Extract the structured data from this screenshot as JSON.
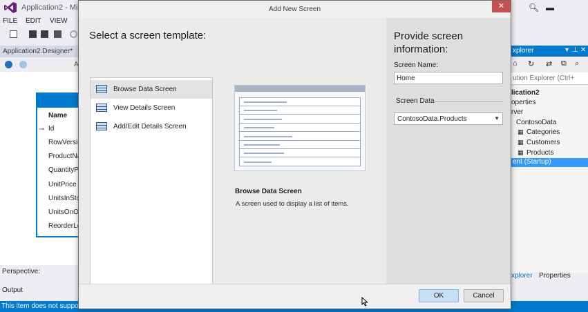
{
  "ide": {
    "title": "Application2 - Micr",
    "menu": [
      "FILE",
      "EDIT",
      "VIEW"
    ],
    "doc_tab": "Application2.Designer*",
    "nav_fragment": "A",
    "entity": {
      "header": "Name",
      "rows": [
        "Id",
        "RowVersic",
        "ProductNa",
        "QuantityP",
        "UnitPrice",
        "UnitsInSto",
        "UnitsOnO",
        "ReorderLe"
      ]
    },
    "perspective_label": "Perspective:",
    "output_label": "Output",
    "status_text": "This item does not support",
    "accent_color": "#007acc"
  },
  "solution_explorer": {
    "header": "xplorer",
    "search_placeholder": "ution Explorer (Ctrl+",
    "tree": [
      {
        "label": "lication2",
        "bold": true
      },
      {
        "label": "operties"
      },
      {
        "label": "rver"
      },
      {
        "label": "ContosoData"
      },
      {
        "label": "Categories"
      },
      {
        "label": "Customers"
      },
      {
        "label": "Products"
      },
      {
        "label": "ent (Startup)",
        "selected": true
      }
    ],
    "tabs": [
      "xplorer",
      "Properties"
    ]
  },
  "dialog": {
    "title": "Add New Screen",
    "close_label": "✕",
    "left_heading": "Select a screen template:",
    "templates": [
      {
        "label": "Browse Data Screen",
        "selected": true
      },
      {
        "label": "View Details Screen"
      },
      {
        "label": "Add/Edit Details Screen"
      }
    ],
    "preview_rows": 8,
    "description_title": "Browse Data Screen",
    "description_text": "A screen used to display a list of items.",
    "right_heading": "Provide screen information:",
    "screen_name_label": "Screen Name:",
    "screen_name_value": "Home",
    "screen_data_label": "Screen Data",
    "screen_data_value": "ContosoData.Products",
    "ok_label": "OK",
    "cancel_label": "Cancel"
  }
}
